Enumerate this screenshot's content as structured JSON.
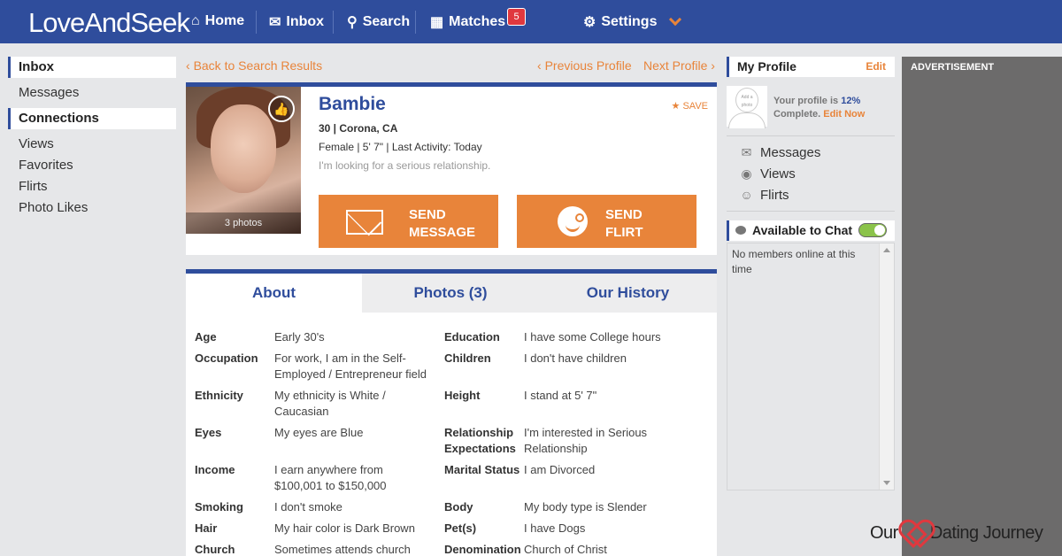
{
  "topbar": {
    "logo": "LoveAndSeek",
    "nav": [
      {
        "label": "Home",
        "icon": "home-icon"
      },
      {
        "label": "Inbox",
        "icon": "envelope-icon"
      },
      {
        "label": "Search",
        "icon": "search-icon"
      },
      {
        "label": "Matches",
        "icon": "matches-icon"
      }
    ],
    "matches_badge": "5",
    "settings_label": "Settings"
  },
  "sidebar": {
    "inbox_heading": "Inbox",
    "inbox_items": [
      "Messages"
    ],
    "connections_heading": "Connections",
    "connections_items": [
      "Views",
      "Favorites",
      "Flirts",
      "Photo Likes"
    ]
  },
  "breadcrumbs": {
    "back": "Back to Search Results",
    "previous": "Previous Profile",
    "next": "Next Profile"
  },
  "profile": {
    "name": "Bambie",
    "age_location": "30 | Corona, CA",
    "details_line": "Female | 5' 7\" | Last Activity: Today",
    "tagline": "I'm looking for a serious relationship.",
    "save_label": "SAVE",
    "photo_count_label": "3 photos",
    "send_message_line1": "SEND",
    "send_message_line2": "MESSAGE",
    "send_flirt_line1": "SEND",
    "send_flirt_line2": "FLIRT"
  },
  "tabs": [
    "About",
    "Photos (3)",
    "Our History"
  ],
  "about": {
    "left": [
      {
        "label": "Age",
        "value": "Early 30's"
      },
      {
        "label": "Occupation",
        "value": "For work, I am in the Self-Employed / Entrepreneur field"
      },
      {
        "label": "Ethnicity",
        "value": "My ethnicity is White / Caucasian"
      },
      {
        "label": "Eyes",
        "value": "My eyes are Blue"
      },
      {
        "label": "Income",
        "value": "I earn anywhere from $100,001 to $150,000"
      },
      {
        "label": "Smoking",
        "value": "I don't smoke"
      },
      {
        "label": "Hair",
        "value": "My hair color is Dark Brown"
      },
      {
        "label": "Church",
        "value": "Sometimes attends church"
      }
    ],
    "right": [
      {
        "label": "Education",
        "value": "I have some College hours"
      },
      {
        "label": "Children",
        "value": "I don't have children"
      },
      {
        "label": "Height",
        "value": "I stand at 5' 7\""
      },
      {
        "label": "Relationship Expectations",
        "value": "I'm interested in Serious Relationship"
      },
      {
        "label": "Marital Status",
        "value": "I am Divorced"
      },
      {
        "label": "Body",
        "value": "My body type is Slender"
      },
      {
        "label": "Pet(s)",
        "value": "I have Dogs"
      },
      {
        "label": "Denomination",
        "value": "Church of Christ"
      }
    ]
  },
  "my_profile": {
    "title": "My Profile",
    "edit": "Edit",
    "avatar_text": "Add a photo",
    "complete_prefix": "Your profile is",
    "complete_pct": "12%",
    "complete_suffix": "Complete.",
    "edit_now": "Edit Now",
    "links": [
      "Messages",
      "Views",
      "Flirts"
    ]
  },
  "chat": {
    "title": "Available to Chat",
    "empty_text": "No members online at this time"
  },
  "ad_label": "ADVERTISEMENT",
  "watermark": {
    "left": "Our",
    "right": "Dating Journey"
  },
  "colors": {
    "brand_blue": "#2f4d9c",
    "accent_orange": "#e8843a",
    "badge_red": "#e0383e"
  }
}
